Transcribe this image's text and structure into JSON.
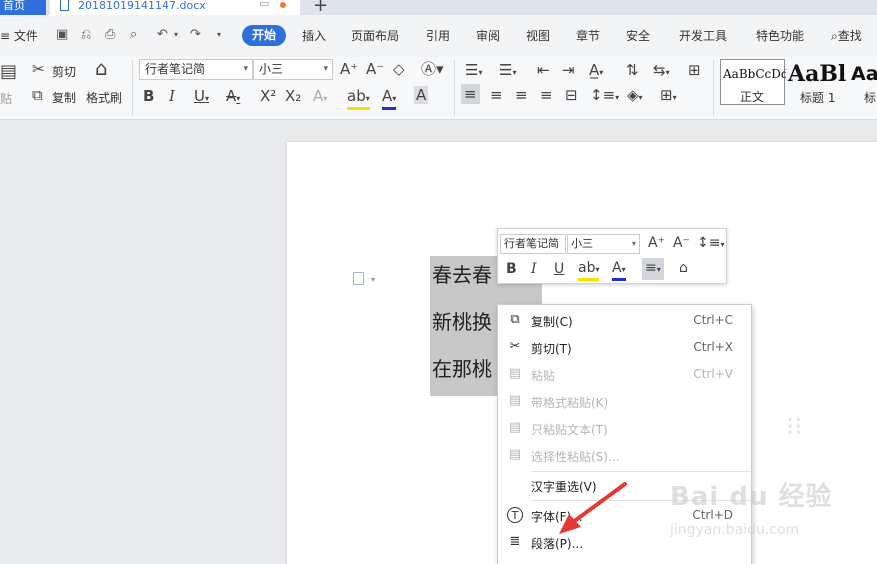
{
  "tabs": {
    "home_label": "首页",
    "doc_name": "20181019141147.docx",
    "new_tab": "+"
  },
  "menubar": {
    "file_label": "文件",
    "items": [
      "开始",
      "插入",
      "页面布局",
      "引用",
      "审阅",
      "视图",
      "章节",
      "安全",
      "开发工具",
      "特色功能"
    ],
    "search_label": "查找"
  },
  "ribbon": {
    "cut_label": "剪切",
    "copy_label": "复制",
    "format_painter_label": "格式刷",
    "paste_label": "贴",
    "font_name": "行者笔记简",
    "font_size": "小三",
    "styles": [
      {
        "preview": "AaBbCcDd",
        "name": "正文"
      },
      {
        "preview": "AaBl",
        "name": "标题 1"
      },
      {
        "preview": "Aa",
        "name": "标"
      }
    ]
  },
  "document": {
    "lines": [
      "春去春",
      "新桃换",
      "在那桃"
    ]
  },
  "mini_toolbar": {
    "font_name": "行者笔记简",
    "font_size": "小三"
  },
  "context_menu": {
    "items": [
      {
        "icon": "copy-icon",
        "label": "复制(C)",
        "shortcut": "Ctrl+C",
        "enabled": true
      },
      {
        "icon": "scissors-icon",
        "label": "剪切(T)",
        "shortcut": "Ctrl+X",
        "enabled": true
      },
      {
        "icon": "paste-icon",
        "label": "粘贴",
        "shortcut": "Ctrl+V",
        "enabled": false
      },
      {
        "icon": "paste-format-icon",
        "label": "带格式粘贴(K)",
        "shortcut": "",
        "enabled": false
      },
      {
        "icon": "paste-text-icon",
        "label": "只粘贴文本(T)",
        "shortcut": "",
        "enabled": false
      },
      {
        "icon": "paste-special-icon",
        "label": "选择性粘贴(S)...",
        "shortcut": "",
        "enabled": false
      },
      {
        "icon": "",
        "label": "汉字重选(V)",
        "shortcut": "",
        "enabled": true
      },
      {
        "icon": "font-icon",
        "label": "字体(F)...",
        "shortcut": "Ctrl+D",
        "enabled": true
      },
      {
        "icon": "paragraph-icon",
        "label": "段落(P)...",
        "shortcut": "",
        "enabled": true
      }
    ]
  },
  "watermark": {
    "brand": "Bai du 经验",
    "url": "jingyan.baidu.com"
  },
  "colors": {
    "accent": "#2f6fdc",
    "selection": "#c8c8c8",
    "arrow": "#e53935"
  }
}
